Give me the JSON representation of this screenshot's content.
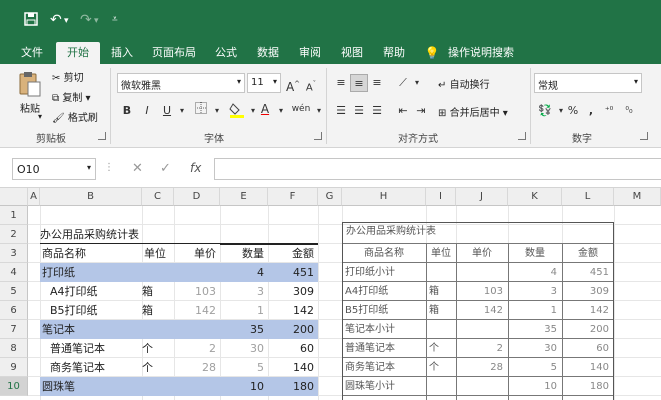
{
  "qat": {
    "save_icon": "save-icon",
    "undo_icon": "undo-icon",
    "redo_icon": "redo-icon",
    "customize_icon": "customize-icon"
  },
  "tabs": [
    "文件",
    "开始",
    "插入",
    "页面布局",
    "公式",
    "数据",
    "审阅",
    "视图",
    "帮助"
  ],
  "tell_me": "操作说明搜索",
  "ribbon": {
    "clipboard": {
      "paste": "粘贴",
      "cut": "剪切",
      "copy": "复制",
      "format_painter": "格式刷",
      "group": "剪贴板"
    },
    "font": {
      "name": "微软雅黑",
      "size": "11",
      "bold": "B",
      "italic": "I",
      "underline": "U",
      "grow": "A",
      "shrink": "A",
      "fill": "A",
      "wen": "wén",
      "group": "字体"
    },
    "alignment": {
      "wrap": "自动换行",
      "merge": "合并后居中",
      "group": "对齐方式"
    },
    "number": {
      "format": "常规",
      "percent": "%",
      "comma": ",",
      "group": "数字"
    }
  },
  "formula_bar": {
    "name_box": "O10",
    "cancel": "✕",
    "enter": "✓",
    "fx": "fx",
    "value": ""
  },
  "columns": [
    "A",
    "B",
    "C",
    "D",
    "E",
    "F",
    "G",
    "H",
    "I",
    "J",
    "K",
    "L",
    "M"
  ],
  "rows": [
    "1",
    "2",
    "3",
    "4",
    "5",
    "6",
    "7",
    "8",
    "9",
    "10"
  ],
  "table1": {
    "title": "办公用品采购统计表",
    "headers": [
      "商品名称",
      "单位",
      "单价",
      "数量",
      "金额"
    ],
    "rows": [
      [
        "打印纸",
        "",
        "",
        "4",
        "451"
      ],
      [
        "A4打印纸",
        "箱",
        "103",
        "3",
        "309"
      ],
      [
        "B5打印纸",
        "箱",
        "142",
        "1",
        "142"
      ],
      [
        "笔记本",
        "",
        "",
        "35",
        "200"
      ],
      [
        "普通笔记本",
        "个",
        "2",
        "30",
        "60"
      ],
      [
        "商务笔记本",
        "个",
        "28",
        "5",
        "140"
      ],
      [
        "圆珠笔",
        "",
        "",
        "10",
        "180"
      ]
    ]
  },
  "table2": {
    "title": "办公用品采购统计表",
    "headers": [
      "商品名称",
      "单位",
      "单价",
      "数量",
      "金额"
    ],
    "rows": [
      [
        "打印纸小计",
        "",
        "",
        "4",
        "451"
      ],
      [
        "A4打印纸",
        "箱",
        "103",
        "3",
        "309"
      ],
      [
        "B5打印纸",
        "箱",
        "142",
        "1",
        "142"
      ],
      [
        "笔记本小计",
        "",
        "",
        "35",
        "200"
      ],
      [
        "普通笔记本",
        "个",
        "2",
        "30",
        "60"
      ],
      [
        "商务笔记本",
        "个",
        "28",
        "5",
        "140"
      ],
      [
        "圆珠笔小计",
        "",
        "",
        "10",
        "180"
      ]
    ]
  },
  "colors": {
    "excel_green": "#217346",
    "band_blue": "#b4c6e7"
  }
}
